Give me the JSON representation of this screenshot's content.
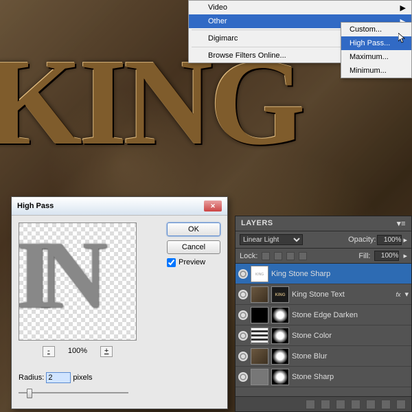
{
  "canvas": {
    "text": "KING"
  },
  "menu": {
    "items": [
      {
        "label": "Video",
        "arrow": "▶"
      },
      {
        "label": "Other",
        "arrow": "▶"
      },
      {
        "label": "Digimarc",
        "arrow": "▶"
      },
      {
        "label": "Browse Filters Online..."
      }
    ],
    "submenu": [
      {
        "label": "Custom..."
      },
      {
        "label": "High Pass..."
      },
      {
        "label": "Maximum..."
      },
      {
        "label": "Minimum..."
      }
    ]
  },
  "dialog": {
    "title": "High Pass",
    "ok": "OK",
    "cancel": "Cancel",
    "preview": "Preview",
    "preview_letters": "IN",
    "zoom": "100%",
    "radius_label": "Radius:",
    "radius_value": "2",
    "radius_unit": "pixels",
    "minus": "-",
    "plus": "+"
  },
  "layers": {
    "tab": "LAYERS",
    "blend": "Linear Light",
    "opacity_label": "Opacity:",
    "opacity": "100%",
    "lock_label": "Lock:",
    "fill_label": "Fill:",
    "fill": "100%",
    "items": [
      {
        "name": "King Stone Sharp"
      },
      {
        "name": "King Stone Text"
      },
      {
        "name": "Stone Edge Darken"
      },
      {
        "name": "Stone Color"
      },
      {
        "name": "Stone Blur"
      },
      {
        "name": "Stone Sharp"
      }
    ],
    "fx": "fx",
    "king_thumb": "KING"
  }
}
